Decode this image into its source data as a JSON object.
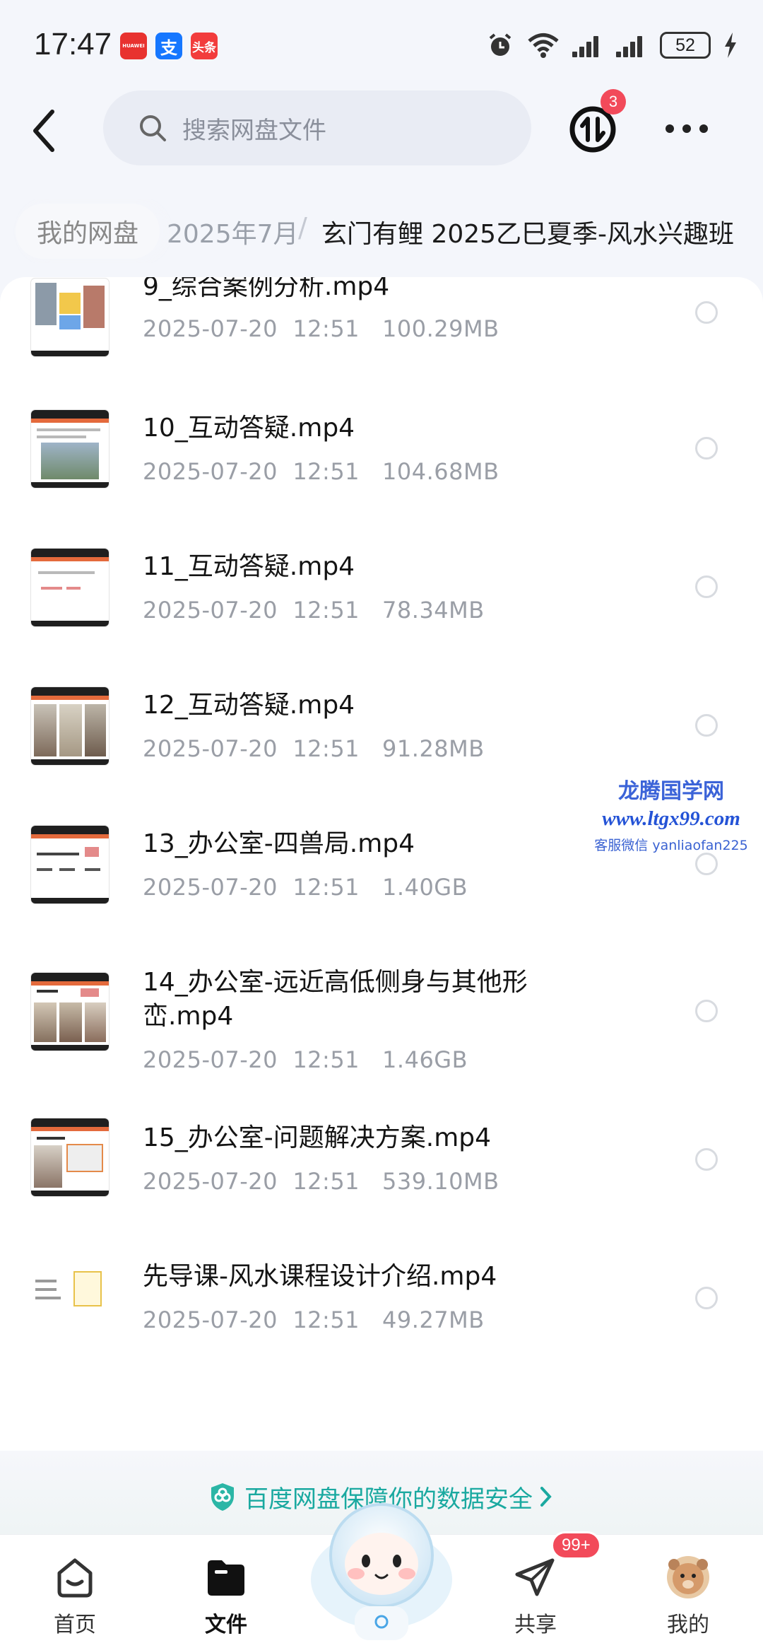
{
  "status_bar": {
    "time": "17:47",
    "apps": [
      "HUAWEI",
      "支",
      "头条"
    ],
    "battery": "52"
  },
  "header": {
    "search_placeholder": "搜索网盘文件",
    "transfer_badge": "3"
  },
  "breadcrumb": {
    "root": "我的网盘",
    "middle": "2025年7月",
    "separator": "/",
    "current": "玄门有鲤 2025乙巳夏季-风水兴趣班"
  },
  "files": [
    {
      "name": "9_综合案例分析.mp4",
      "date": "2025-07-20",
      "time": "12:51",
      "size": "100.29MB"
    },
    {
      "name": "10_互动答疑.mp4",
      "date": "2025-07-20",
      "time": "12:51",
      "size": "104.68MB"
    },
    {
      "name": "11_互动答疑.mp4",
      "date": "2025-07-20",
      "time": "12:51",
      "size": "78.34MB"
    },
    {
      "name": "12_互动答疑.mp4",
      "date": "2025-07-20",
      "time": "12:51",
      "size": "91.28MB"
    },
    {
      "name": "13_办公室-四兽局.mp4",
      "date": "2025-07-20",
      "time": "12:51",
      "size": "1.40GB"
    },
    {
      "name": "14_办公室-远近高低侧身与其他形峦.mp4",
      "date": "2025-07-20",
      "time": "12:51",
      "size": "1.46GB"
    },
    {
      "name": "15_办公室-问题解决方案.mp4",
      "date": "2025-07-20",
      "time": "12:51",
      "size": "539.10MB"
    },
    {
      "name": "先导课-风水课程设计介绍.mp4",
      "date": "2025-07-20",
      "time": "12:51",
      "size": "49.27MB"
    }
  ],
  "watermark": {
    "line1": "龙腾国学网",
    "line2": "www.ltgx99.com",
    "line3": "客服微信 yanliaofan225"
  },
  "security_banner": {
    "text": "百度网盘保障你的数据安全",
    "color": "#1aa9a0"
  },
  "bottom_nav": {
    "items": [
      {
        "label": "首页",
        "icon": "home-icon"
      },
      {
        "label": "文件",
        "icon": "folder-icon"
      },
      {
        "label": "共享",
        "icon": "share-plane-icon"
      },
      {
        "label": "我的",
        "icon": "avatar-icon"
      }
    ],
    "share_badge": "99+"
  }
}
